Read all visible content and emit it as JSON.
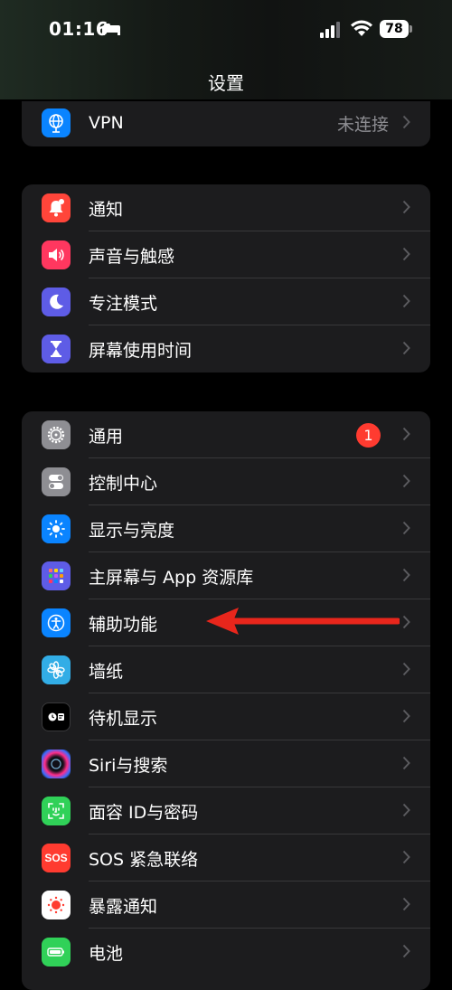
{
  "status_bar": {
    "time": "01:16",
    "battery": "78"
  },
  "nav": {
    "title": "设置"
  },
  "groups": [
    {
      "rows": [
        {
          "label": "VPN",
          "value": "未连接",
          "icon": "vpn-globe-icon",
          "color": "#0a84ff"
        }
      ]
    },
    {
      "rows": [
        {
          "label": "通知",
          "icon": "bell-icon",
          "color": "#ff453a"
        },
        {
          "label": "声音与触感",
          "icon": "speaker-icon",
          "color": "#ff375f"
        },
        {
          "label": "专注模式",
          "icon": "moon-icon",
          "color": "#5e5ce6"
        },
        {
          "label": "屏幕使用时间",
          "icon": "hourglass-icon",
          "color": "#5e5ce6"
        }
      ]
    },
    {
      "rows": [
        {
          "label": "通用",
          "badge": "1",
          "icon": "gear-icon",
          "color": "#8e8e93"
        },
        {
          "label": "控制中心",
          "icon": "toggles-icon",
          "color": "#8e8e93"
        },
        {
          "label": "显示与亮度",
          "icon": "sun-icon",
          "color": "#0a84ff"
        },
        {
          "label": "主屏幕与 App 资源库",
          "icon": "home-grid-icon",
          "color": "#5e5ce6"
        },
        {
          "label": "辅助功能",
          "icon": "accessibility-icon",
          "color": "#0a84ff"
        },
        {
          "label": "墙纸",
          "icon": "flower-icon",
          "color": "#32ade6"
        },
        {
          "label": "待机显示",
          "icon": "standby-icon",
          "color": "#000000"
        },
        {
          "label": "Siri与搜索",
          "icon": "siri-icon",
          "color": "#1c1c1e"
        },
        {
          "label": "面容 ID与密码",
          "icon": "face-id-icon",
          "color": "#30d158"
        },
        {
          "label": "SOS 紧急联络",
          "icon": "sos-icon",
          "color": "#ff3b30"
        },
        {
          "label": "暴露通知",
          "icon": "exposure-icon",
          "color": "#ffffff"
        },
        {
          "label": "电池",
          "icon": "battery-icon",
          "color": "#30d158"
        }
      ]
    }
  ],
  "sos_text": "SOS",
  "annotation": {
    "color": "#e8261c"
  }
}
